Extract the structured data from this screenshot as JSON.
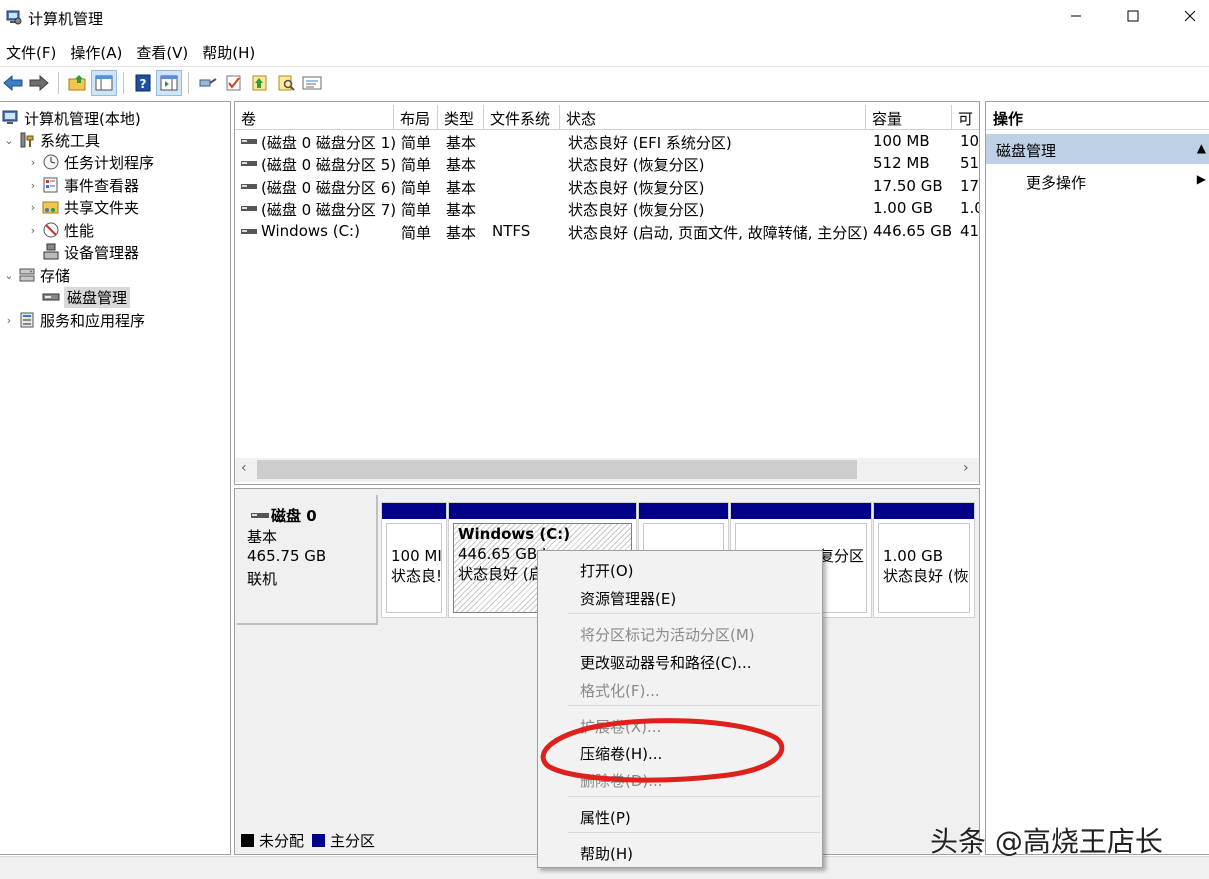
{
  "window": {
    "title": "计算机管理"
  },
  "menu": [
    "文件(F)",
    "操作(A)",
    "查看(V)",
    "帮助(H)"
  ],
  "toolbar": {
    "icons": [
      "back-arrow-icon",
      "forward-arrow-icon",
      "folder-up-icon",
      "show-hide-tree-icon",
      "help-icon",
      "show-hide-action-pane-icon",
      "connect-icon",
      "check-icon",
      "import-icon",
      "search-icon",
      "properties-icon"
    ]
  },
  "tree": {
    "root": "计算机管理(本地)",
    "system_tools": "系统工具",
    "task_scheduler": "任务计划程序",
    "event_viewer": "事件查看器",
    "shared_folders": "共享文件夹",
    "performance": "性能",
    "device_manager": "设备管理器",
    "storage": "存储",
    "disk_management": "磁盘管理",
    "services_apps": "服务和应用程序"
  },
  "volume_table": {
    "columns": [
      "卷",
      "布局",
      "类型",
      "文件系统",
      "状态",
      "容量",
      "可"
    ],
    "rows": [
      {
        "name": "(磁盘 0 磁盘分区 1)",
        "layout": "简单",
        "type": "基本",
        "fs": "",
        "status": "状态良好 (EFI 系统分区)",
        "capacity": "100 MB",
        "avail": "10"
      },
      {
        "name": "(磁盘 0 磁盘分区 5)",
        "layout": "简单",
        "type": "基本",
        "fs": "",
        "status": "状态良好 (恢复分区)",
        "capacity": "512 MB",
        "avail": "51"
      },
      {
        "name": "(磁盘 0 磁盘分区 6)",
        "layout": "简单",
        "type": "基本",
        "fs": "",
        "status": "状态良好 (恢复分区)",
        "capacity": "17.50 GB",
        "avail": "17"
      },
      {
        "name": "(磁盘 0 磁盘分区 7)",
        "layout": "简单",
        "type": "基本",
        "fs": "",
        "status": "状态良好 (恢复分区)",
        "capacity": "1.00 GB",
        "avail": "1.0"
      },
      {
        "name": "Windows (C:)",
        "layout": "简单",
        "type": "基本",
        "fs": "NTFS",
        "status": "状态良好 (启动, 页面文件, 故障转储, 主分区)",
        "capacity": "446.65 GB",
        "avail": "41"
      }
    ]
  },
  "disk": {
    "name": "磁盘 0",
    "type": "基本",
    "size": "465.75 GB",
    "state": "联机",
    "partitions": [
      {
        "line1": "100 MI",
        "line2": "状态良!"
      },
      {
        "title": "Windows  (C:)",
        "line1": "446.65 GB I",
        "line2": "状态良好 (启"
      },
      {
        "line1": "",
        "line2": ""
      },
      {
        "line1": "",
        "line2": "复分区"
      },
      {
        "line1": "1.00 GB",
        "line2": "状态良好 (恢"
      }
    ]
  },
  "legend": {
    "unallocated": "未分配",
    "primary": "主分区"
  },
  "actions": {
    "title": "操作",
    "section": "磁盘管理",
    "more": "更多操作"
  },
  "context_menu": {
    "open": "打开(O)",
    "explorer": "资源管理器(E)",
    "mark_active": "将分区标记为活动分区(M)",
    "change_letter": "更改驱动器号和路径(C)...",
    "format": "格式化(F)...",
    "extend": "扩展卷(X)...",
    "shrink": "压缩卷(H)...",
    "delete": "删除卷(D)...",
    "properties": "属性(P)",
    "help": "帮助(H)"
  },
  "watermark": "头条 @高烧王店长",
  "colors": {
    "partition_bar": "#00008b",
    "unallocated": "#000000",
    "annotation": "#e0201c",
    "action_header": "#bed0e6"
  }
}
